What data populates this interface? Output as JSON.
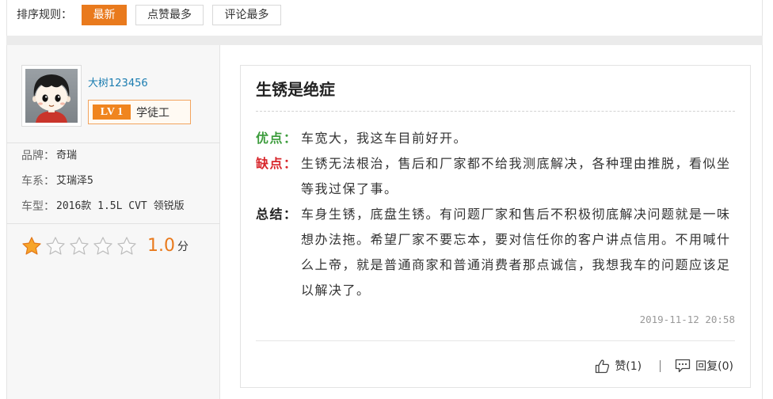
{
  "colors": {
    "accent": "#e97a1d",
    "pros": "#3c9c3c",
    "cons": "#d8262b",
    "link": "#1a7cb0"
  },
  "sort_bar": {
    "label": "排序规则：",
    "options": [
      {
        "label": "最新",
        "active": true
      },
      {
        "label": "点赞最多",
        "active": false
      },
      {
        "label": "评论最多",
        "active": false
      }
    ]
  },
  "user": {
    "avatar_icon": "cartoon-avatar-icon",
    "name": "大树123456",
    "level": "LV 1",
    "level_title": "学徒工"
  },
  "car_info": [
    {
      "label": "品牌：",
      "value": "奇瑞"
    },
    {
      "label": "车系：",
      "value": "艾瑞泽5"
    },
    {
      "label": "车型：",
      "value": "2016款 1.5L CVT 领锐版"
    }
  ],
  "rating": {
    "star_icon": "star-icon",
    "stars_filled": 1,
    "stars_total": 5,
    "score": "1.0",
    "unit": "分"
  },
  "review": {
    "title": "生锈是绝症",
    "pros_label": "优点：",
    "pros": "车宽大，我这车目前好开。",
    "cons_label": "缺点：",
    "cons": "生锈无法根治，售后和厂家都不给我测底解决，各种理由推脱，看似坐等我过保了事。",
    "summary_label": "总结：",
    "summary": "车身生锈，底盘生锈。有问题厂家和售后不积极彻底解决问题就是一味想办法拖。希望厂家不要忘本，要对信任你的客户讲点信用。不用喊什么上帝，就是普通商家和普通消费者那点诚信，我想我车的问题应该足以解决了。",
    "date": "2019-11-12 20:58"
  },
  "actions": {
    "like_icon": "thumbs-up-icon",
    "like_label": "赞(1)",
    "reply_icon": "comment-icon",
    "reply_label": "回复(0)"
  }
}
